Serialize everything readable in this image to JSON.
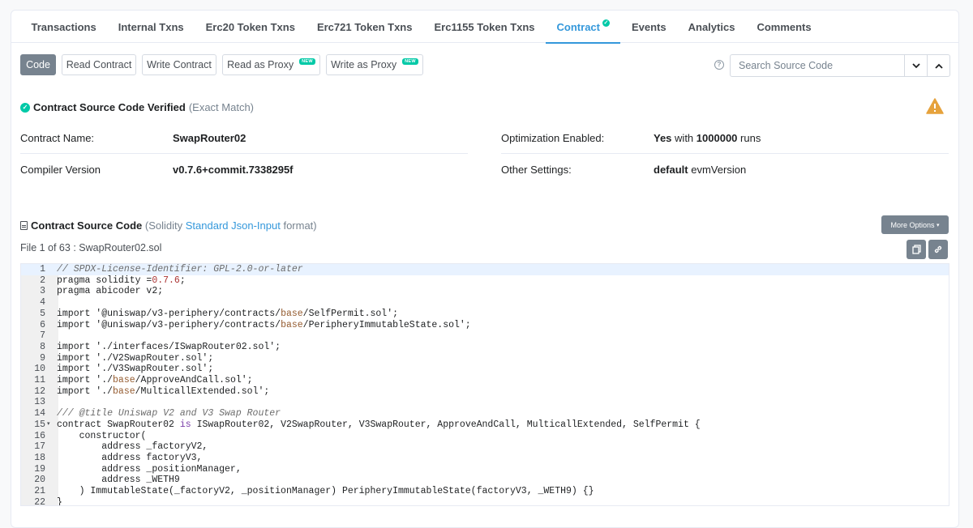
{
  "tabs": [
    {
      "label": "Transactions",
      "active": false
    },
    {
      "label": "Internal Txns",
      "active": false
    },
    {
      "label": "Erc20 Token Txns",
      "active": false
    },
    {
      "label": "Erc721 Token Txns",
      "active": false
    },
    {
      "label": "Erc1155 Token Txns",
      "active": false
    },
    {
      "label": "Contract",
      "active": true
    },
    {
      "label": "Events",
      "active": false
    },
    {
      "label": "Analytics",
      "active": false
    },
    {
      "label": "Comments",
      "active": false
    }
  ],
  "toolbar": {
    "code": "Code",
    "read_contract": "Read Contract",
    "write_contract": "Write Contract",
    "read_proxy": "Read as Proxy",
    "write_proxy": "Write as Proxy",
    "new_badge": "NEW",
    "help": "?",
    "search_placeholder": "Search Source Code"
  },
  "verified": {
    "title": "Contract Source Code Verified",
    "match": "(Exact Match)"
  },
  "info": {
    "contract_name_label": "Contract Name:",
    "contract_name": "SwapRouter02",
    "compiler_label": "Compiler Version",
    "compiler": "v0.7.6+commit.7338295f",
    "optimization_label": "Optimization Enabled:",
    "optimization_yes": "Yes",
    "optimization_with": "with",
    "optimization_runs_count": "1000000",
    "optimization_runs": "runs",
    "other_label": "Other Settings:",
    "other_default": "default",
    "other_evm": "evmVersion"
  },
  "source": {
    "title": "Contract Source Code",
    "paren_open": "(Solidity",
    "link": "Standard Json-Input",
    "paren_close": "format)",
    "more_options": "More Options",
    "file_info": "File 1 of 63 : SwapRouter02.sol"
  },
  "code_lines": [
    "// SPDX-License-Identifier: GPL-2.0-or-later",
    "pragma solidity =0.7.6;",
    "pragma abicoder v2;",
    "",
    "import '@uniswap/v3-periphery/contracts/base/SelfPermit.sol';",
    "import '@uniswap/v3-periphery/contracts/base/PeripheryImmutableState.sol';",
    "",
    "import './interfaces/ISwapRouter02.sol';",
    "import './V2SwapRouter.sol';",
    "import './V3SwapRouter.sol';",
    "import './base/ApproveAndCall.sol';",
    "import './base/MulticallExtended.sol';",
    "",
    "/// @title Uniswap V2 and V3 Swap Router",
    "contract SwapRouter02 is ISwapRouter02, V2SwapRouter, V3SwapRouter, ApproveAndCall, MulticallExtended, SelfPermit {",
    "    constructor(",
    "        address _factoryV2,",
    "        address factoryV3,",
    "        address _positionManager,",
    "        address _WETH9",
    "    ) ImmutableState(_factoryV2, _positionManager) PeripheryImmutableState(factoryV3, _WETH9) {}",
    "}"
  ]
}
